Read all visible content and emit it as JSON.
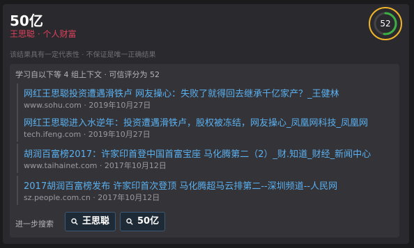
{
  "answer": "50亿",
  "entity": {
    "person": "王思聪",
    "separator": "·",
    "category": "个人财富"
  },
  "disclaimer": "该结果具有一定代表性 · 不保证是唯一正确结果",
  "score": {
    "value": "52",
    "fraction": 0.52,
    "ring_color": "#f0b429",
    "progress_color": "#3cb043"
  },
  "sources_header": "学习自以下等 4 组上下文 · 可信评分为 52",
  "source_groups": [
    [
      {
        "title": "网红王思聪投资遭遇滑铁卢 网友操心：失败了就得回去继承千亿家产？_王健林",
        "domain": "www.sohu.com",
        "date": "2019年10月27日"
      },
      {
        "title": "网红王思聪进入水逆年：投资遭遇滑铁卢，股权被冻结，网友操心_凤凰网科技_凤凰网",
        "domain": "tech.ifeng.com",
        "date": "2019年10月27日"
      }
    ],
    [
      {
        "title": "胡润百富榜2017：许家印首登中国首富宝座 马化腾第二（2）_财.知道_财经_新闻中心",
        "domain": "www.taihainet.com",
        "date": "2017年10月12日"
      }
    ],
    [
      {
        "title": "2017胡润百富榜发布 许家印首次登顶 马化腾超马云排第二--深圳频道--人民网",
        "domain": "sz.people.com.cn",
        "date": "2017年10月12日"
      }
    ]
  ],
  "further_search_label": "进一步搜索",
  "further_search_chips": [
    "王思聪",
    "50亿"
  ],
  "meta_sep": "·"
}
